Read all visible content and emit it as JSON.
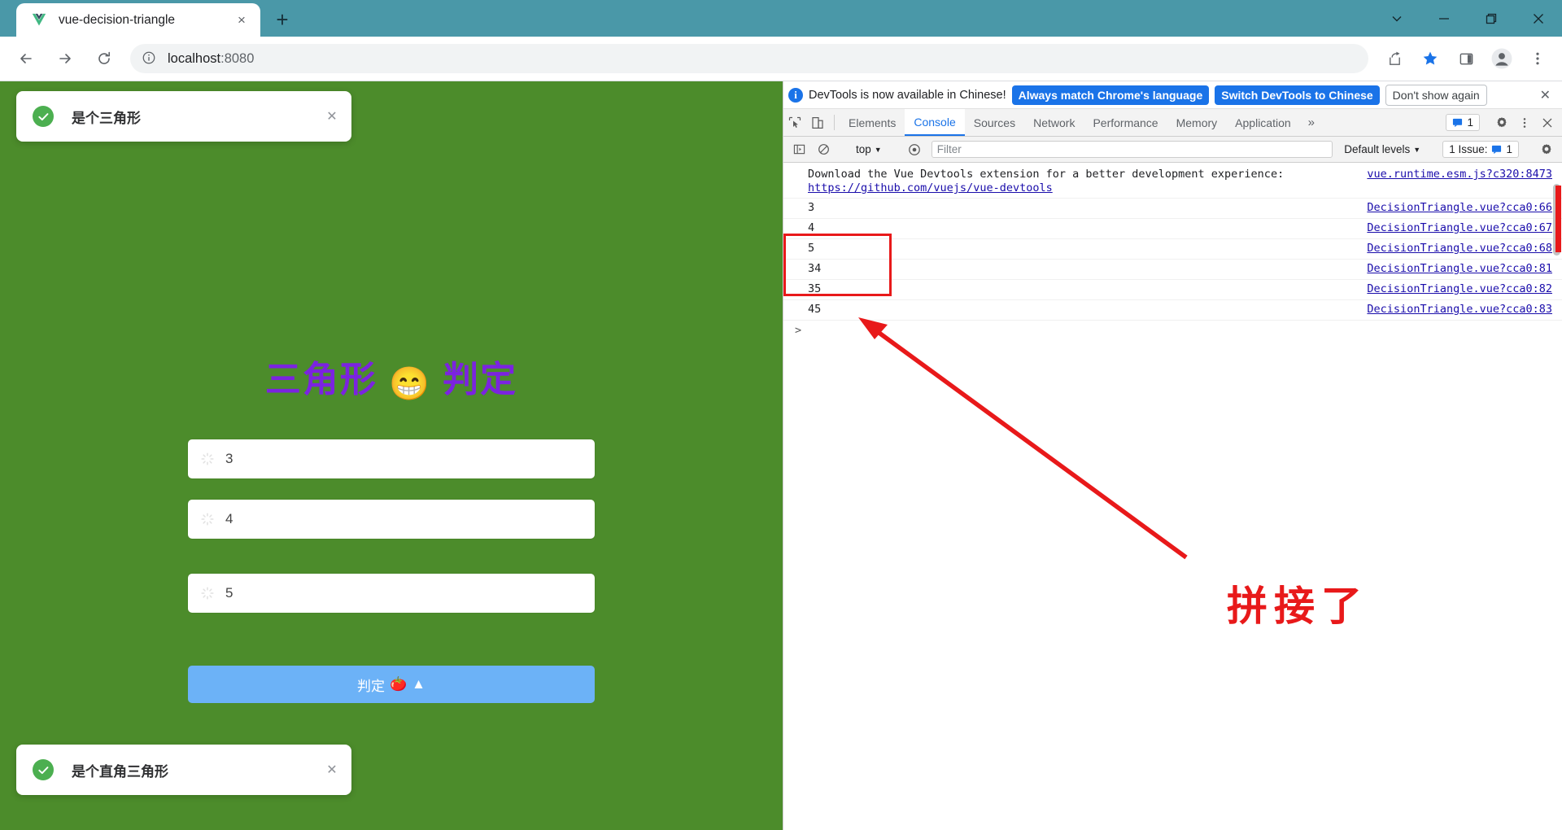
{
  "browser": {
    "tab": {
      "title": "vue-decision-triangle",
      "favicon": "vue-logo-icon",
      "close": "×"
    },
    "new_tab_label": "+",
    "window_controls": {
      "minimize": "—",
      "maximize": "❐",
      "close": "✕",
      "collapse": "∨"
    },
    "omnibox": {
      "host": "localhost",
      "port": ":8080",
      "site_info_icon": "info-circle-icon"
    },
    "toolbar_icons": [
      "back-arrow-icon",
      "forward-arrow-icon",
      "reload-icon",
      "share-icon",
      "bookmark-star-icon",
      "sidepanel-icon",
      "profile-avatar-icon",
      "kebab-menu-icon"
    ]
  },
  "app": {
    "title_text": "三角形",
    "title_emoji": "😁",
    "title_text2": "判定",
    "toast_top": {
      "message": "是个三角形",
      "close": "✕",
      "icon": "check-circle-icon"
    },
    "toast_bottom": {
      "message": "是个直角三角形",
      "close": "✕",
      "icon": "check-circle-icon"
    },
    "inputs": [
      {
        "value": "3",
        "placeholder": "",
        "icon": "loading-spinner-icon"
      },
      {
        "value": "4",
        "placeholder": "",
        "icon": "loading-spinner-icon"
      },
      {
        "value": "5",
        "placeholder": "",
        "icon": "loading-spinner-icon"
      }
    ],
    "button": {
      "label": "判定",
      "emoji1": "🍅",
      "emoji2": "▲"
    },
    "bg_color": "#4c8c2b",
    "title_color": "#7b23e0",
    "button_color": "#6cb2f7"
  },
  "devtools": {
    "banner": {
      "message": "DevTools is now available in Chinese!",
      "primary_btn": "Always match Chrome's language",
      "secondary_btn": "Switch DevTools to Chinese",
      "ghost_btn": "Don't show again",
      "close": "✕"
    },
    "tabs": [
      {
        "label": "Elements",
        "active": false
      },
      {
        "label": "Console",
        "active": true
      },
      {
        "label": "Sources",
        "active": false
      },
      {
        "label": "Network",
        "active": false
      },
      {
        "label": "Performance",
        "active": false
      },
      {
        "label": "Memory",
        "active": false
      },
      {
        "label": "Application",
        "active": false
      }
    ],
    "more_tabs": "»",
    "issue_chip": {
      "count": "1",
      "icon": "issue-message-icon"
    },
    "settings_icon": "gear-icon",
    "kebab_icon": "kebab-menu-icon",
    "close_icon": "close-icon",
    "filterbar": {
      "sidebar_icon": "console-sidebar-icon",
      "clear_icon": "clear-console-icon",
      "context": "top",
      "context_caret": "▼",
      "eye_icon": "live-expression-icon",
      "filter_placeholder": "Filter",
      "filter_value": "",
      "levels_label": "Default levels",
      "levels_caret": "▼",
      "issues_label": "1 Issue:",
      "issues_count": "1",
      "settings_icon": "gear-icon"
    },
    "logs": [
      {
        "message": "Download the Vue Devtools extension for a better development experience:\n",
        "link": "https://github.com/vuejs/vue-devtools",
        "source": "vue.runtime.esm.js?c320:8473",
        "highlight": false
      },
      {
        "message": "3",
        "link": "",
        "source": "DecisionTriangle.vue?cca0:66",
        "highlight": false
      },
      {
        "message": "4",
        "link": "",
        "source": "DecisionTriangle.vue?cca0:67",
        "highlight": false
      },
      {
        "message": "5",
        "link": "",
        "source": "DecisionTriangle.vue?cca0:68",
        "highlight": false
      },
      {
        "message": "34",
        "link": "",
        "source": "DecisionTriangle.vue?cca0:81",
        "highlight": true
      },
      {
        "message": "35",
        "link": "",
        "source": "DecisionTriangle.vue?cca0:82",
        "highlight": true
      },
      {
        "message": "45",
        "link": "",
        "source": "DecisionTriangle.vue?cca0:83",
        "highlight": true
      }
    ],
    "prompt": ">"
  },
  "annotation": {
    "text": "拼接了",
    "color": "#e8191a"
  }
}
